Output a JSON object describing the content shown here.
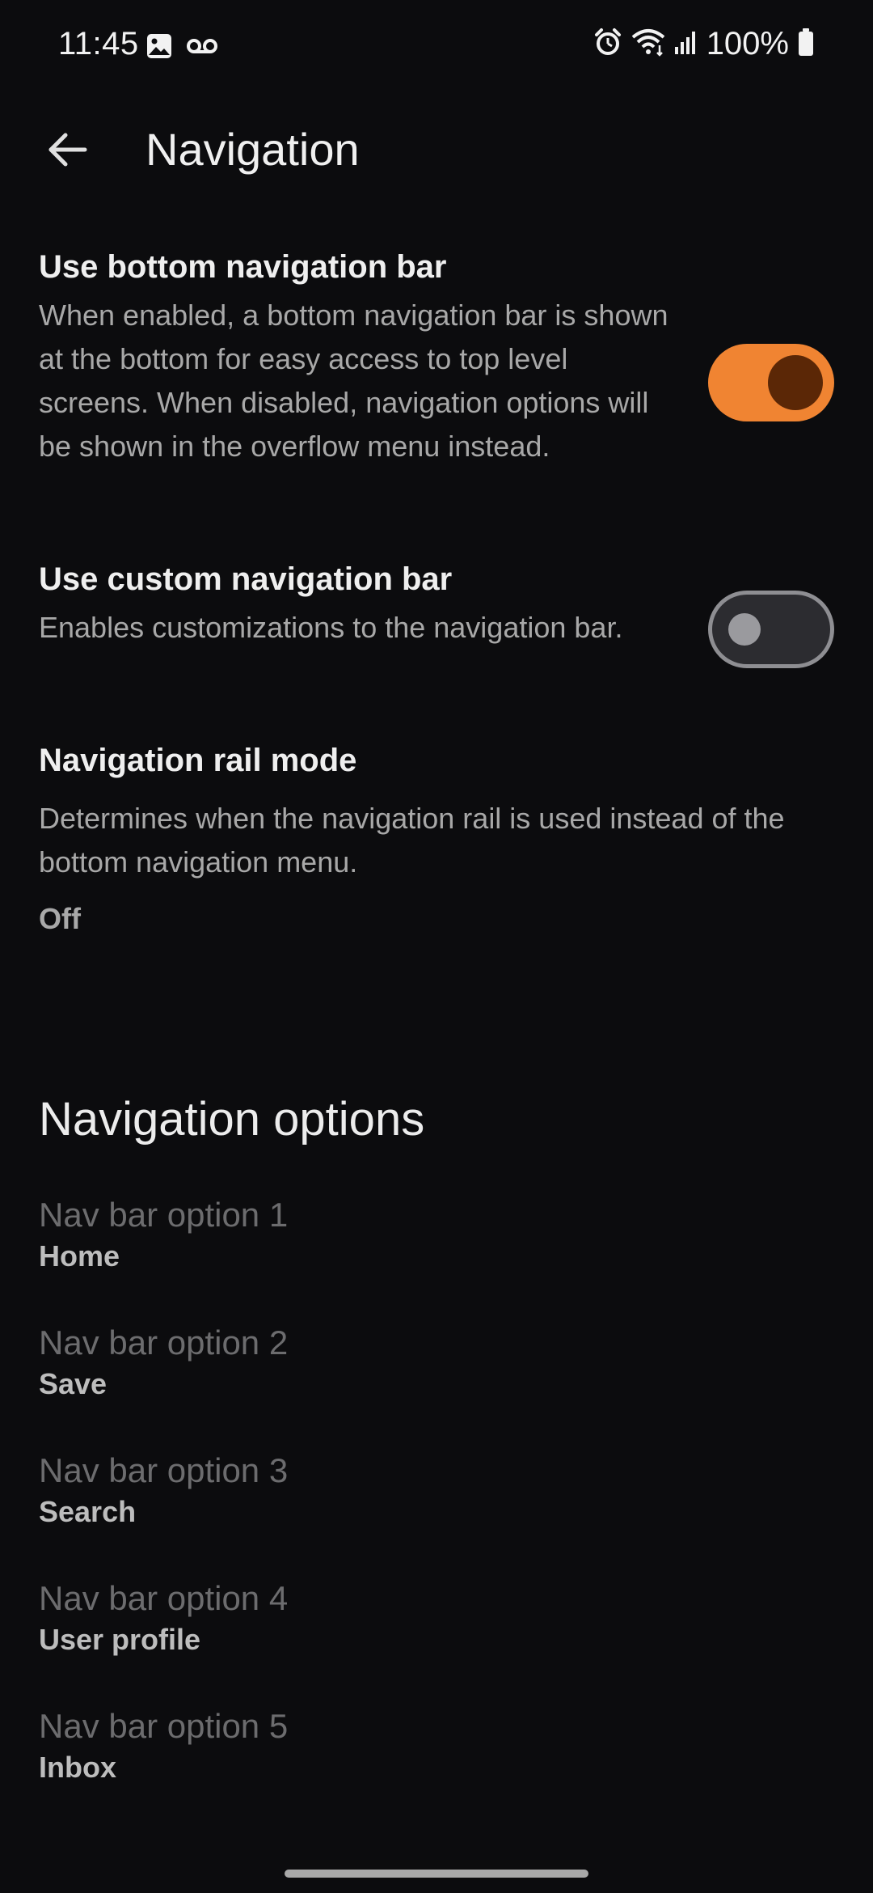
{
  "status_bar": {
    "time": "11:45",
    "battery": "100%",
    "icons": [
      "gallery-icon",
      "voicemail-icon",
      "alarm-icon",
      "wifi-icon",
      "signal-icon",
      "battery-icon"
    ]
  },
  "app_bar": {
    "title": "Navigation",
    "back_icon": "arrow-back-icon"
  },
  "settings": {
    "bottom_nav": {
      "title": "Use bottom navigation bar",
      "description": "When enabled, a bottom navigation bar is shown at the bottom for easy access to top level screens. When disabled, navigation options will be shown in the overflow menu instead.",
      "enabled": true
    },
    "custom_nav": {
      "title": "Use custom navigation bar",
      "description": "Enables customizations to the navigation bar.",
      "enabled": false
    },
    "rail_mode": {
      "title": "Navigation rail mode",
      "description": "Determines when the navigation rail is used instead of the bottom navigation menu.",
      "value": "Off"
    }
  },
  "nav_options": {
    "header": "Navigation options",
    "items": [
      {
        "label": "Nav bar option 1",
        "value": "Home"
      },
      {
        "label": "Nav bar option 2",
        "value": "Save"
      },
      {
        "label": "Nav bar option 3",
        "value": "Search"
      },
      {
        "label": "Nav bar option 4",
        "value": "User profile"
      },
      {
        "label": "Nav bar option 5",
        "value": "Inbox"
      }
    ]
  },
  "colors": {
    "background": "#0c0c0e",
    "accent": "#f08432",
    "accent_thumb": "#5b2706"
  }
}
